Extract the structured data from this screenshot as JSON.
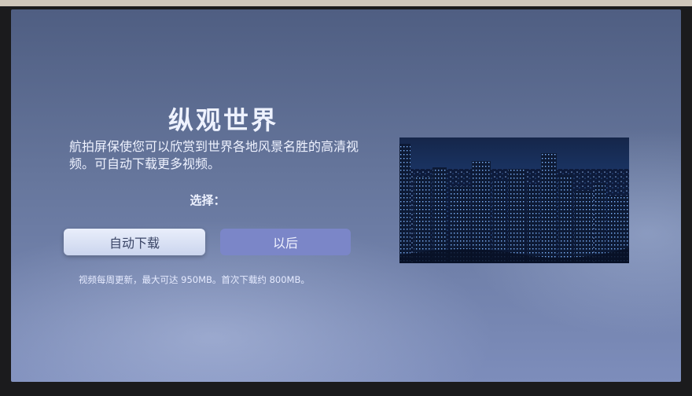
{
  "screen": {
    "title": "纵观世界",
    "description": "航拍屏保使您可以欣赏到世界各地风景名胜的高清视频。可自动下载更多视频。",
    "choose_label": "选择：",
    "buttons": {
      "auto_download": "自动下载",
      "later": "以后"
    },
    "note": "视频每周更新，最大可达 950MB。首次下载约 800MB。"
  },
  "colors": {
    "screen_top": "#4f5e82",
    "screen_bottom": "#7d8dbb",
    "primary_button": "#e9eefb",
    "secondary_button": "#7b86c8"
  }
}
